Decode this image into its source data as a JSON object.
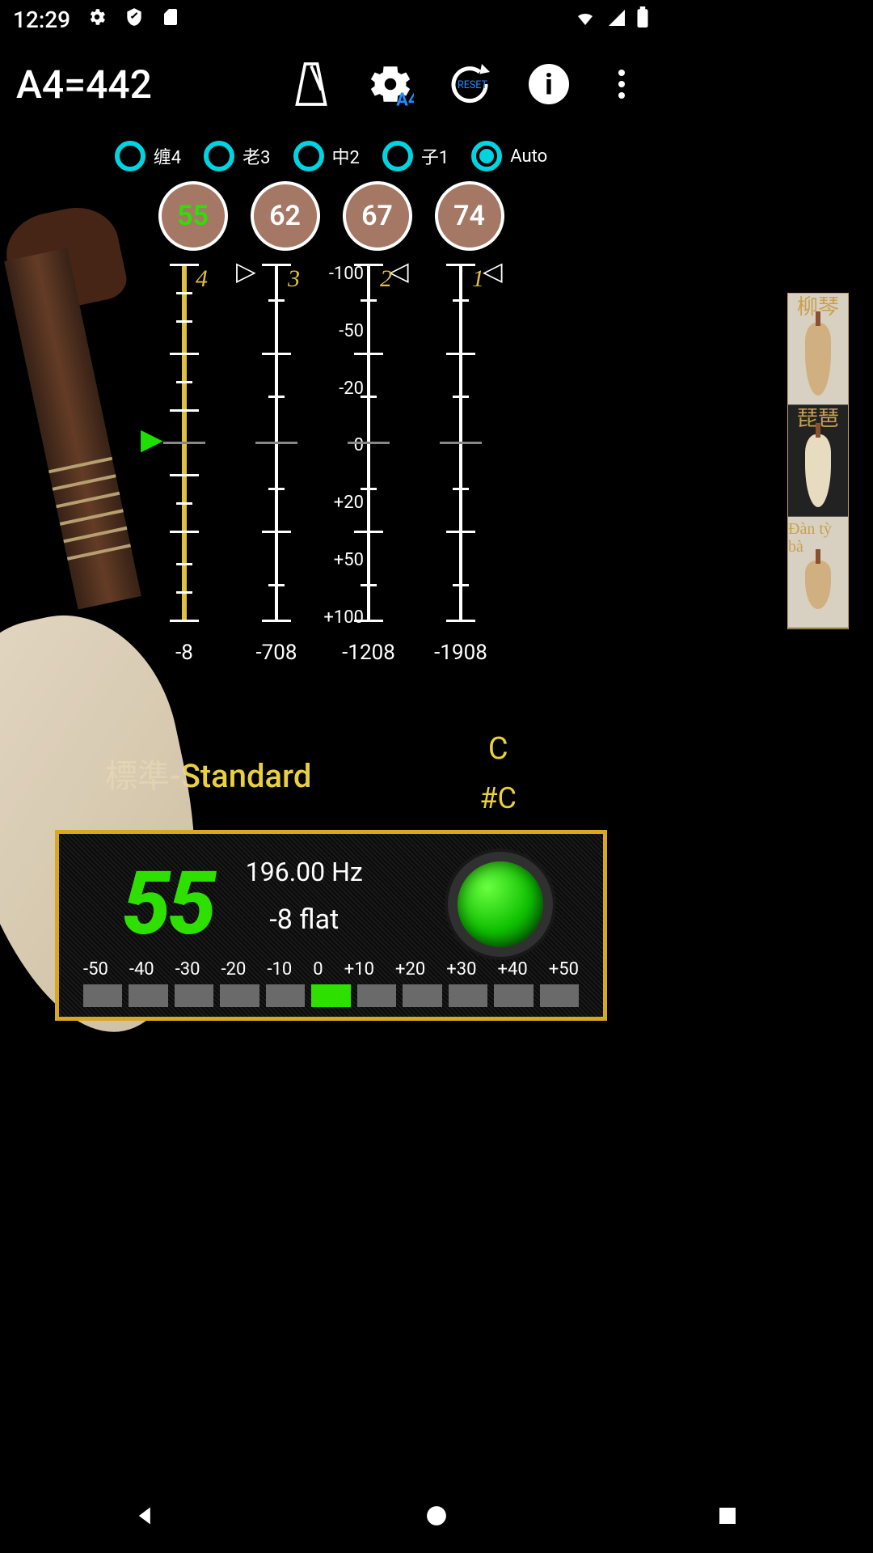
{
  "status": {
    "time": "12:29"
  },
  "header": {
    "title": "A4=442"
  },
  "radios": [
    {
      "label": "缠4",
      "active": false
    },
    {
      "label": "老3",
      "active": false
    },
    {
      "label": "中2",
      "active": false
    },
    {
      "label": "子1",
      "active": false
    },
    {
      "label": "Auto",
      "active": true
    }
  ],
  "midi": [
    {
      "val": "55",
      "active": true
    },
    {
      "val": "62",
      "active": false
    },
    {
      "val": "67",
      "active": false
    },
    {
      "val": "74",
      "active": false
    }
  ],
  "meters": {
    "nums": [
      "4",
      "3",
      "2",
      "1"
    ],
    "bottoms": [
      "-8",
      "-708",
      "-1208",
      "-1908"
    ],
    "center": [
      "-100",
      "-50",
      "-20",
      "0",
      "+20",
      "+50",
      "+100"
    ]
  },
  "side_instruments": [
    "柳琴",
    "琵琶",
    "Đàn tỳ bà"
  ],
  "tuning": {
    "name": "標準-Standard",
    "note": "C",
    "note_sharp": "#C"
  },
  "display": {
    "big": "55",
    "freq": "196.00 Hz",
    "cents": "-8 flat",
    "scale": [
      "-50",
      "-40",
      "-30",
      "-20",
      "-10",
      "0",
      "+10",
      "+20",
      "+30",
      "+40",
      "+50"
    ],
    "active_index": 5
  },
  "toolbar": {
    "reset": "RESET",
    "a4": "A4"
  }
}
